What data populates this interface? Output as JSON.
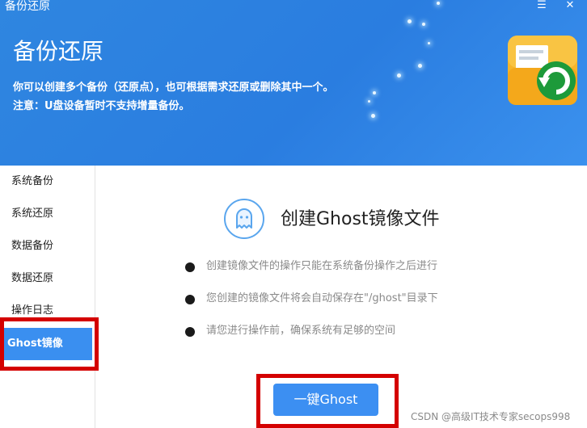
{
  "window": {
    "title": "备份还原",
    "menu_icon": "hamburger-menu-icon",
    "close_icon": "close-icon"
  },
  "header": {
    "title": "备份还原",
    "description_line1": "你可以创建多个备份（还原点），也可根据需求还原或删除其中一个。",
    "description_line2": "注意：U盘设备暂时不支持增量备份。",
    "app_icon": "backup-restore-folder-icon",
    "accent_color": "#2a7de0"
  },
  "sidebar": {
    "items": [
      {
        "label": "系统备份"
      },
      {
        "label": "系统还原"
      },
      {
        "label": "数据备份"
      },
      {
        "label": "数据还原"
      },
      {
        "label": "操作日志"
      },
      {
        "label": "Ghost镜像",
        "active": true
      }
    ],
    "active_color": "#3a8ff0"
  },
  "main": {
    "title": "创建Ghost镜像文件",
    "title_icon": "ghost-icon",
    "notes": [
      "创建镜像文件的操作只能在系统备份操作之后进行",
      "您创建的镜像文件将会自动保存在\"/ghost\"目录下",
      "请您进行操作前，确保系统有足够的空间"
    ],
    "primary_button": "一键Ghost"
  },
  "watermark": "CSDN @高级IT技术专家secops998"
}
